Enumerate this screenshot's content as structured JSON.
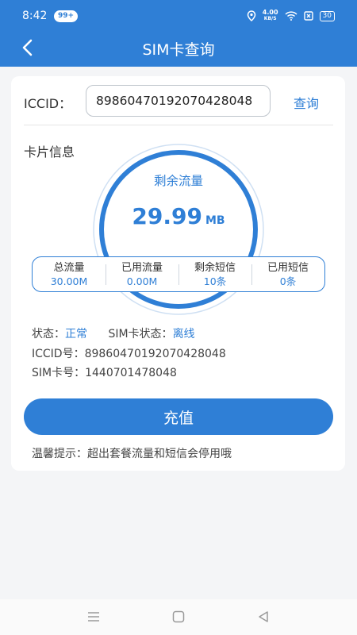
{
  "status_bar": {
    "time": "8:42",
    "badge": "99+",
    "net_speed_value": "4.00",
    "net_speed_unit": "KB/S",
    "battery": "30"
  },
  "header": {
    "title": "SIM卡查询"
  },
  "search": {
    "label": "ICCID：",
    "value": "89860470192070428048",
    "button": "查询"
  },
  "card_info": {
    "title": "卡片信息",
    "gauge_label": "剩余流量",
    "remaining_value": "29.99",
    "remaining_unit": "MB",
    "remaining_fraction": 0.9997
  },
  "stats": [
    {
      "label": "总流量",
      "value": "30.00M"
    },
    {
      "label": "已用流量",
      "value": "0.00M"
    },
    {
      "label": "剩余短信",
      "value": "10条"
    },
    {
      "label": "已用短信",
      "value": "0条"
    }
  ],
  "details": {
    "status_label": "状态：",
    "status_value": "正常",
    "sim_status_label": "SIM卡状态：",
    "sim_status_value": "离线",
    "iccid_line": "ICCID号：89860470192070428048",
    "sim_no_line": "SIM卡号：1440701478048"
  },
  "recharge_button": "充值",
  "tip": "温馨提示：超出套餐流量和短信会停用哦",
  "colors": {
    "primary": "#2f7fd6",
    "background": "#f4f5f7"
  },
  "icons": [
    "back-arrow-icon",
    "location-icon",
    "wifi-icon",
    "sim-icon",
    "battery-icon",
    "menu-icon",
    "home-icon",
    "back-triangle-icon"
  ]
}
